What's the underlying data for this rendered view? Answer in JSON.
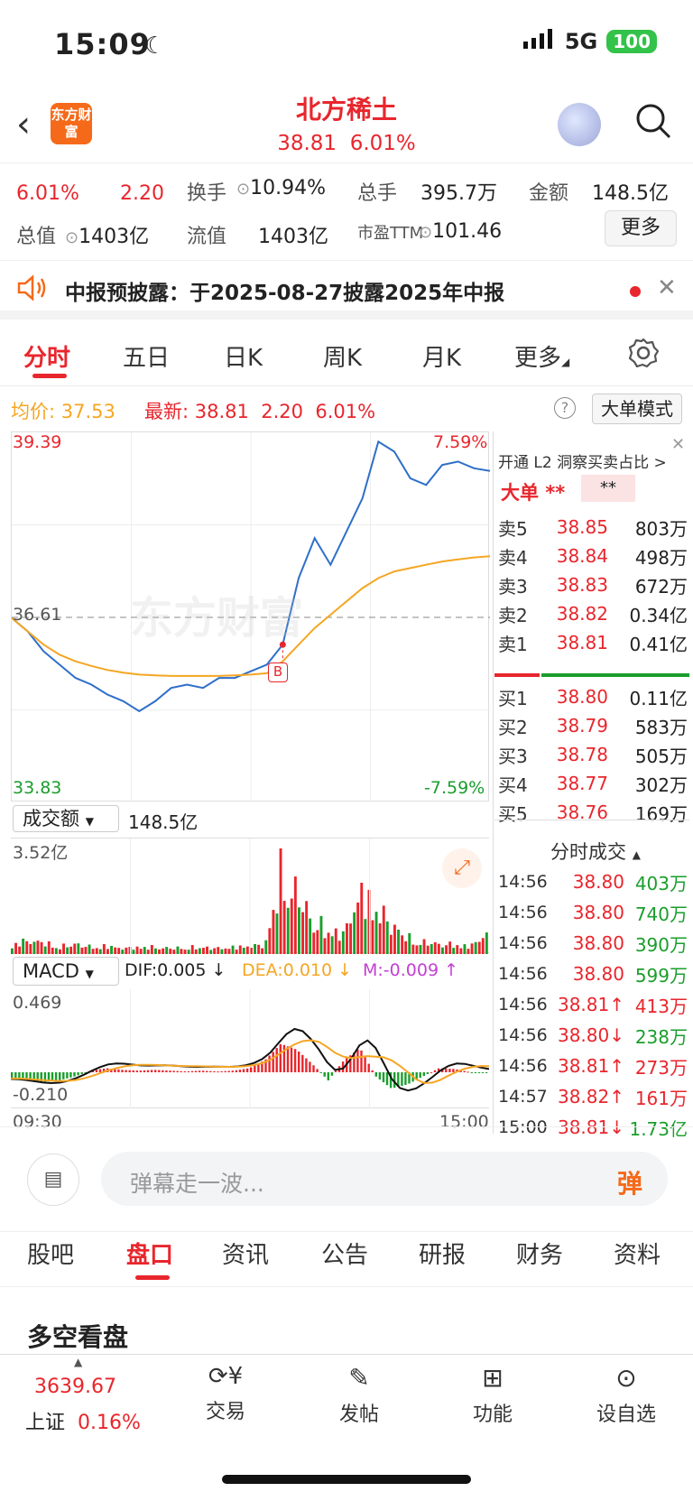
{
  "status_bar": {
    "time": "15:09",
    "network": "5G",
    "battery": "100"
  },
  "header": {
    "logo_text": "东方财富",
    "title": "北方稀土",
    "price": "38.81",
    "change_pct": "6.01%"
  },
  "quote": {
    "change_pct": "6.01%",
    "change": "2.20",
    "turnover_label": "换手",
    "turnover": "10.94%",
    "total_hands_label": "总手",
    "total_hands": "395.7万",
    "amount_label": "金额",
    "amount": "148.5亿",
    "total_cap_label": "总值",
    "total_cap": "1403亿",
    "float_cap_label": "流值",
    "float_cap": "1403亿",
    "pe_label": "市盈TTM",
    "pe": "101.46",
    "more_button": "更多"
  },
  "notice": {
    "text": "中报预披露：于2025-08-27披露2025年中报"
  },
  "chart_tabs": [
    "分时",
    "五日",
    "日K",
    "周K",
    "月K",
    "更多"
  ],
  "info_line": {
    "avg_label": "均价:",
    "avg": "37.53",
    "latest_label": "最新:",
    "latest": "38.81",
    "change": "2.20",
    "pct": "6.01%",
    "mode_button": "大单模式"
  },
  "chart_labels": {
    "price_max": "39.39",
    "price_prev": "36.61",
    "price_min": "33.83",
    "pct_max": "7.59%",
    "pct_min": "-7.59%",
    "buy_marker": "B",
    "watermark": "东方财富",
    "volume_selector": "成交额",
    "volume_total": "148.5亿",
    "volume_max": "3.52亿",
    "macd_selector": "MACD",
    "dif": "DIF:0.005 ↓",
    "dea": "DEA:0.010 ↓",
    "m": "M:-0.009 ↑",
    "macd_max": "0.469",
    "macd_min": "-0.210",
    "time_start": "09:30",
    "time_end": "15:00"
  },
  "chart_data": {
    "type": "line",
    "title": "",
    "xlabel": "",
    "ylabel": "",
    "ylim": [
      33.83,
      39.39
    ],
    "prev_close": 36.61,
    "series": [
      {
        "name": "price",
        "color": "#2e6fc9",
        "values": [
          36.6,
          36.4,
          36.1,
          35.9,
          35.7,
          35.6,
          35.45,
          35.35,
          35.2,
          35.35,
          35.55,
          35.6,
          35.55,
          35.7,
          35.7,
          35.8,
          35.9,
          36.2,
          37.2,
          37.8,
          37.4,
          37.9,
          38.4,
          39.25,
          39.1,
          38.7,
          38.6,
          38.9,
          38.95,
          38.85,
          38.81
        ]
      },
      {
        "name": "avg",
        "color": "#f5a623",
        "values": [
          36.6,
          36.4,
          36.2,
          36.05,
          35.95,
          35.88,
          35.82,
          35.78,
          35.75,
          35.74,
          35.73,
          35.73,
          35.73,
          35.73,
          35.74,
          35.75,
          35.77,
          35.95,
          36.2,
          36.45,
          36.65,
          36.85,
          37.05,
          37.2,
          37.3,
          37.35,
          37.4,
          37.45,
          37.48,
          37.51,
          37.53
        ]
      }
    ],
    "volume": [
      0.4,
      0.6,
      0.5,
      0.3,
      0.45,
      0.3,
      0.35,
      0.25,
      0.3,
      0.3,
      0.25,
      0.28,
      0.3,
      0.25,
      0.3,
      0.35,
      0.4,
      3.5,
      2.6,
      1.5,
      1.0,
      0.9,
      2.7,
      2.0,
      1.3,
      0.7,
      0.5,
      0.45,
      0.4,
      0.35,
      0.9
    ],
    "macd": [
      -0.08,
      -0.1,
      -0.12,
      -0.1,
      -0.05,
      0.02,
      0.05,
      0.03,
      0.02,
      0.03,
      0.02,
      0.01,
      0.02,
      0.01,
      0.02,
      0.05,
      0.15,
      0.35,
      0.28,
      0.1,
      -0.1,
      0.15,
      0.3,
      -0.05,
      -0.2,
      -0.15,
      -0.05,
      0.05,
      0.04,
      0.0,
      -0.01
    ]
  },
  "order_book": {
    "l2_promo": "开通 L2 洞察买卖占比 >",
    "big_order_label": "大单",
    "big_order_val1": "**",
    "big_order_val2": "**",
    "asks": [
      {
        "label": "卖5",
        "price": "38.85",
        "vol": "803万"
      },
      {
        "label": "卖4",
        "price": "38.84",
        "vol": "498万"
      },
      {
        "label": "卖3",
        "price": "38.83",
        "vol": "672万"
      },
      {
        "label": "卖2",
        "price": "38.82",
        "vol": "0.34亿"
      },
      {
        "label": "卖1",
        "price": "38.81",
        "vol": "0.41亿"
      }
    ],
    "bids": [
      {
        "label": "买1",
        "price": "38.80",
        "vol": "0.11亿"
      },
      {
        "label": "买2",
        "price": "38.79",
        "vol": "583万"
      },
      {
        "label": "买3",
        "price": "38.78",
        "vol": "505万"
      },
      {
        "label": "买4",
        "price": "38.77",
        "vol": "302万"
      },
      {
        "label": "买5",
        "price": "38.76",
        "vol": "169万"
      }
    ]
  },
  "trades": {
    "header": "分时成交",
    "rows": [
      {
        "time": "14:56",
        "price": "38.80",
        "vol": "403万",
        "dir": ""
      },
      {
        "time": "14:56",
        "price": "38.80",
        "vol": "740万",
        "dir": ""
      },
      {
        "time": "14:56",
        "price": "38.80",
        "vol": "390万",
        "dir": ""
      },
      {
        "time": "14:56",
        "price": "38.80",
        "vol": "599万",
        "dir": ""
      },
      {
        "time": "14:56",
        "price": "38.81↑",
        "vol": "413万",
        "dir": "up"
      },
      {
        "time": "14:56",
        "price": "38.80↓",
        "vol": "238万",
        "dir": "down"
      },
      {
        "time": "14:56",
        "price": "38.81↑",
        "vol": "273万",
        "dir": "up"
      },
      {
        "time": "14:57",
        "price": "38.82↑",
        "vol": "161万",
        "dir": "up"
      },
      {
        "time": "15:00",
        "price": "38.81↓",
        "vol": "1.73亿",
        "dir": "down"
      }
    ]
  },
  "danmu": {
    "placeholder": "弹幕走一波...",
    "button": "弹"
  },
  "bottom_tabs": [
    "股吧",
    "盘口",
    "资讯",
    "公告",
    "研报",
    "财务",
    "资料"
  ],
  "section_title": "多空看盘",
  "footer": {
    "index_value": "3639.67",
    "index_name": "上证",
    "index_pct": "0.16%",
    "items": [
      "交易",
      "发帖",
      "功能",
      "设自选"
    ]
  }
}
